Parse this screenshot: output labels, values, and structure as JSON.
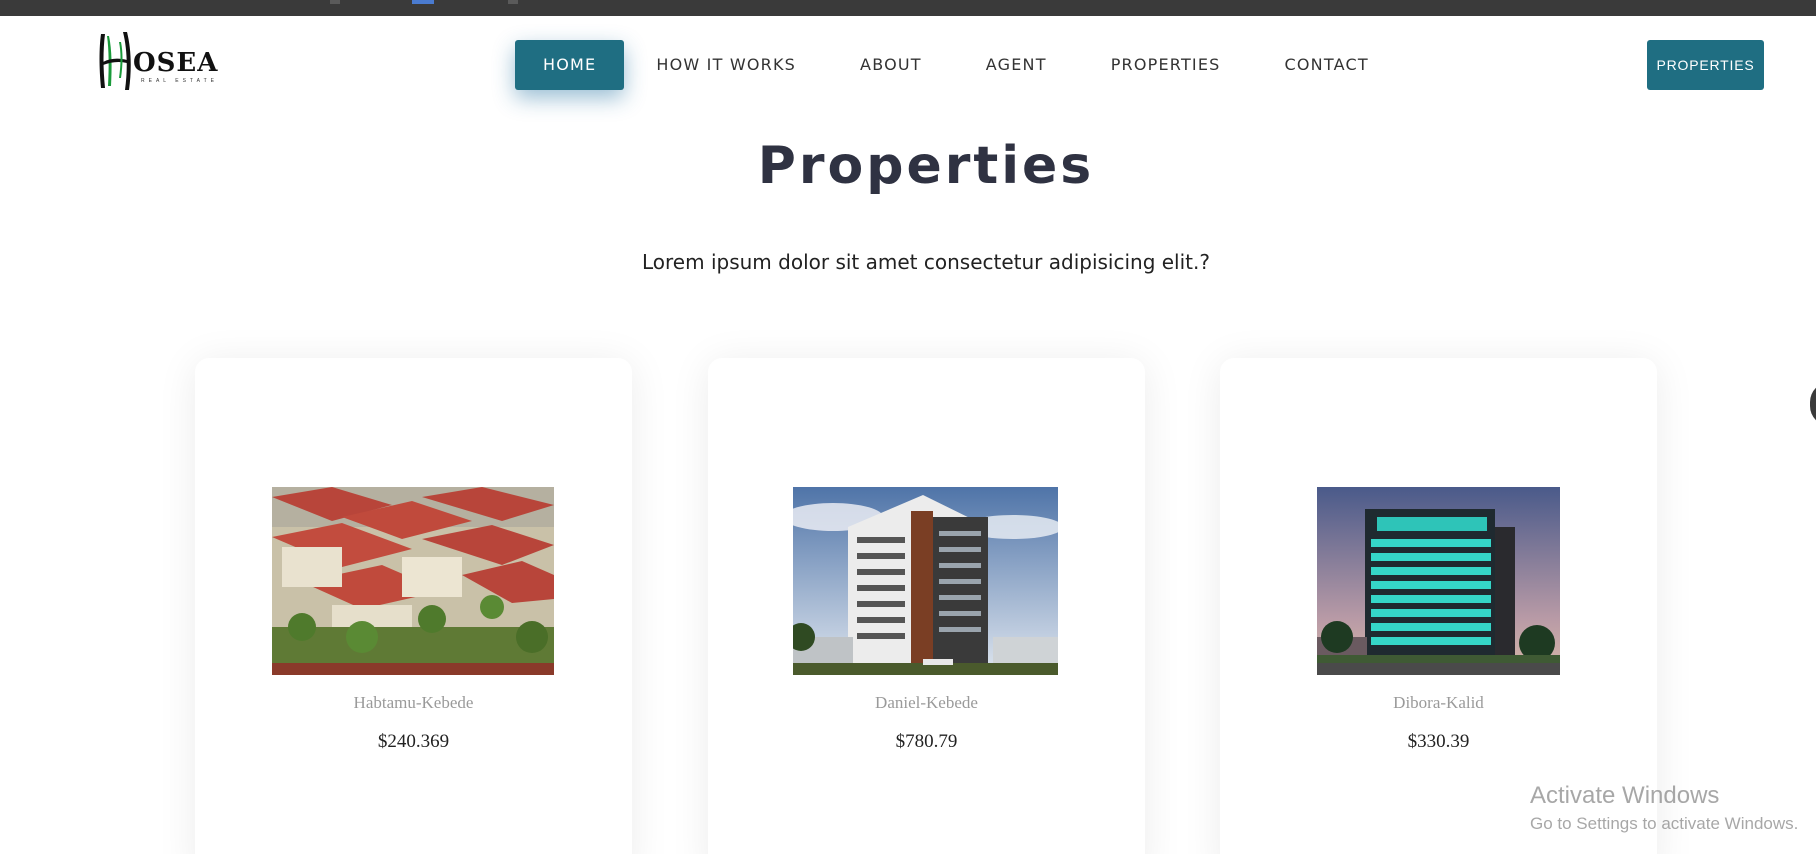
{
  "header": {
    "logo": {
      "text": "OSEA",
      "subtext": "REAL ESTATE"
    },
    "nav": [
      {
        "label": "HOME",
        "active": true
      },
      {
        "label": "HOW IT WORKS",
        "active": false
      },
      {
        "label": "ABOUT",
        "active": false
      },
      {
        "label": "AGENT",
        "active": false
      },
      {
        "label": "PROPERTIES",
        "active": false
      },
      {
        "label": "CONTACT",
        "active": false
      }
    ],
    "cta_label": "PROPERTIES"
  },
  "main": {
    "title": "Properties",
    "subtitle": "Lorem ipsum dolor sit amet consectetur adipisicing elit.?",
    "cards": [
      {
        "name": "Habtamu-Kebede",
        "price": "$240.369"
      },
      {
        "name": "Daniel-Kebede",
        "price": "$780.79"
      },
      {
        "name": "Dibora-Kalid",
        "price": "$330.39"
      }
    ]
  },
  "watermark": {
    "title": "Activate Windows",
    "subtitle": "Go to Settings to activate Windows."
  },
  "colors": {
    "accent": "#1f6e82",
    "title": "#2f3242",
    "name_gray": "#9a9a9a"
  }
}
